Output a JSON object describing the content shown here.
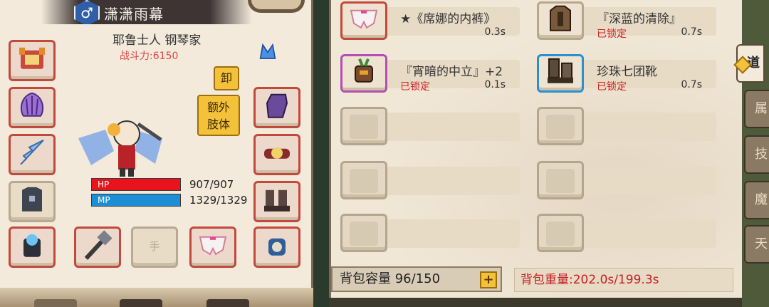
{
  "character": {
    "gender_symbol": "♂",
    "name": "潇潇雨幕",
    "class": "耶鲁士人 钢琴家",
    "combat_power": "战斗力:6150",
    "hp_label": "HP",
    "hp_value": "907/907",
    "mp_label": "MP",
    "mp_value": "1329/1329"
  },
  "buttons": {
    "unequip": "卸",
    "extra_limb_line1": "额外",
    "extra_limb_line2": "肢体"
  },
  "equipment_slots": {
    "hand_label": "手"
  },
  "inventory": {
    "items": [
      {
        "name": "★《席娜的内裤》",
        "status": "",
        "weight": "0.3s"
      },
      {
        "name": "『深蓝的清除』",
        "status": "已锁定",
        "weight": "0.7s"
      },
      {
        "name": "『宵暗的中立』+2",
        "status": "已锁定",
        "weight": "0.1s"
      },
      {
        "name": "珍珠七团靴",
        "status": "已锁定",
        "weight": "0.7s"
      }
    ],
    "capacity_text": "背包容量 96/150",
    "add_symbol": "+",
    "weight_text": "背包重量:202.0s/199.3s"
  },
  "side_tabs": [
    "道",
    "属",
    "技",
    "魔",
    "天"
  ],
  "colors": {
    "hp": "#e8131b",
    "mp": "#1d8ed6",
    "locked_text": "#d02424",
    "button_gold": "#f4c23a"
  }
}
